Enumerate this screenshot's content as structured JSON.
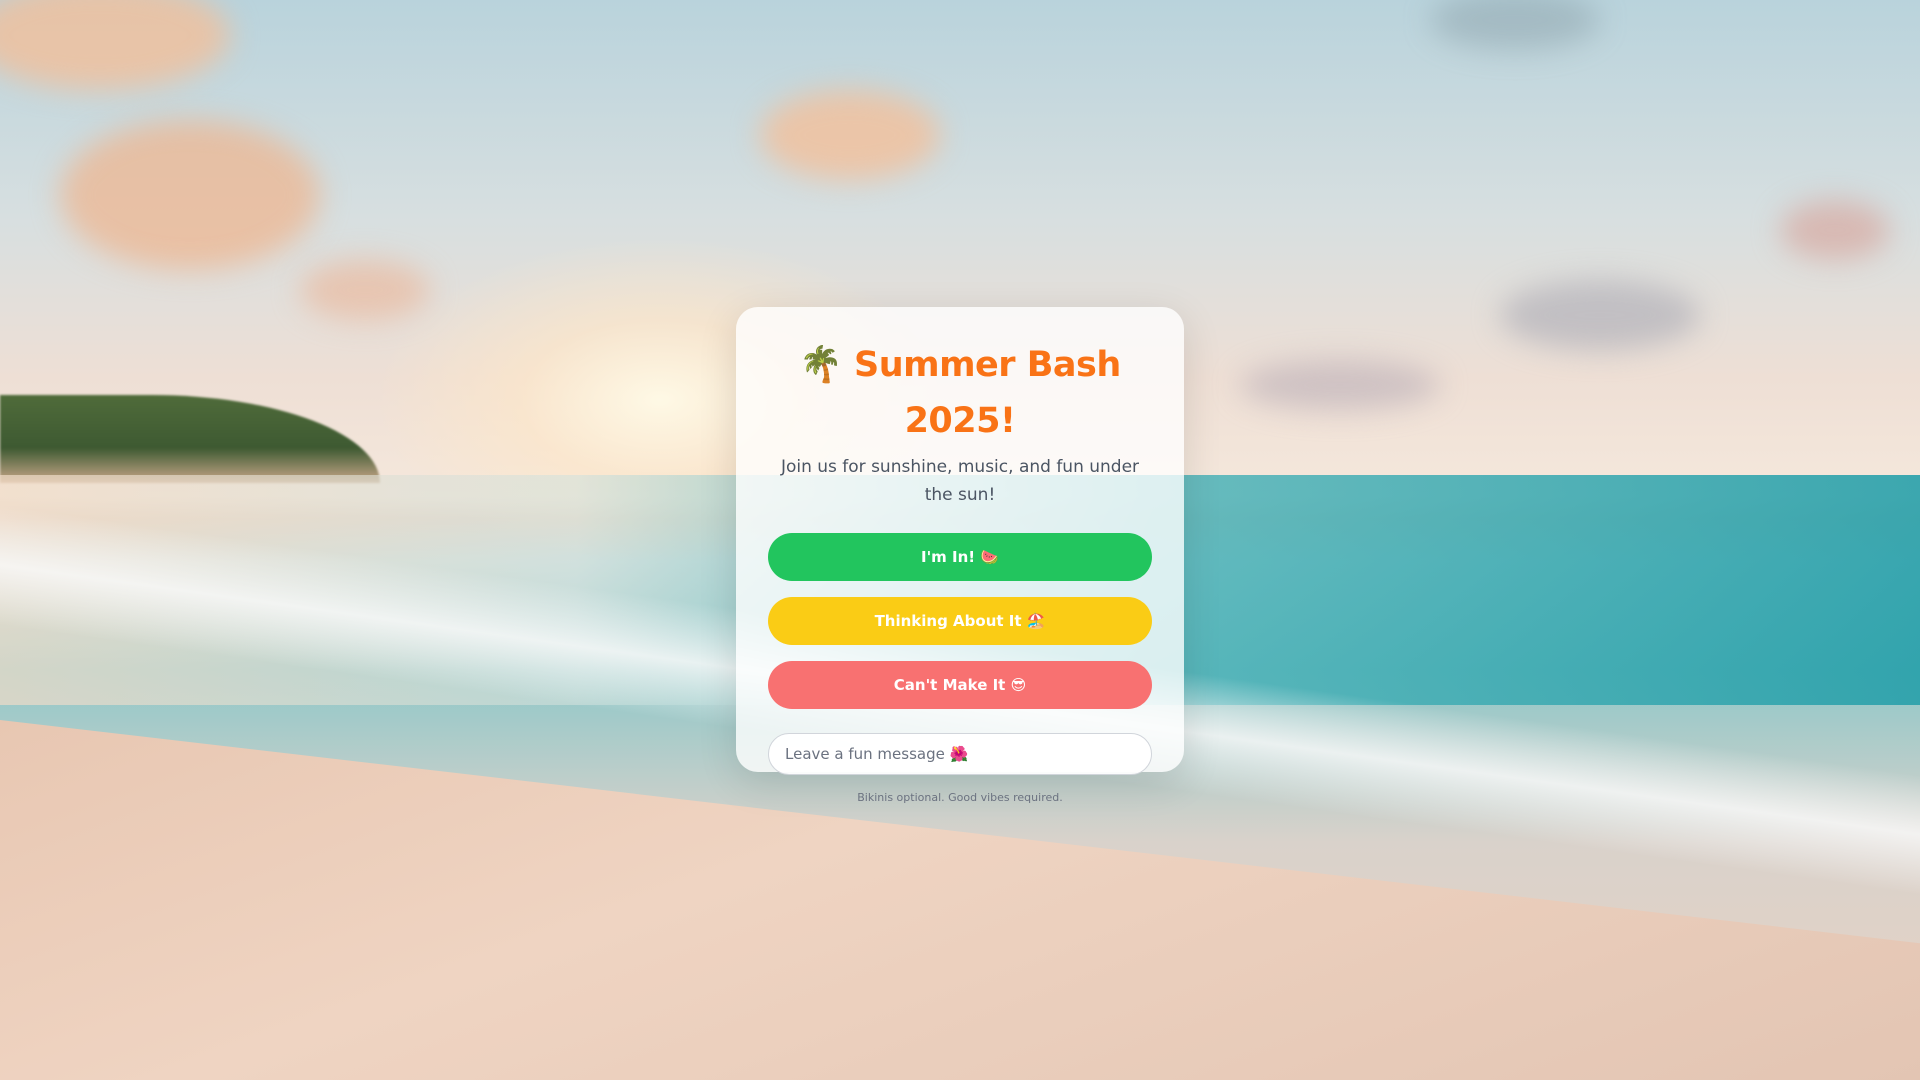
{
  "invite": {
    "title": "🌴 Summer Bash 2025!",
    "subtitle": "Join us for sunshine, music, and fun under the sun!",
    "buttons": {
      "yes": "I'm In! 🍉",
      "maybe": "Thinking About It 🏖️",
      "no": "Can't Make It 😎"
    },
    "message_placeholder": "Leave a fun message 🌺",
    "message_value": "",
    "footnote": "Bikinis optional. Good vibes required."
  },
  "colors": {
    "title": "#f97316",
    "yes": "#22c55e",
    "maybe": "#facc15",
    "no": "#f87171"
  }
}
